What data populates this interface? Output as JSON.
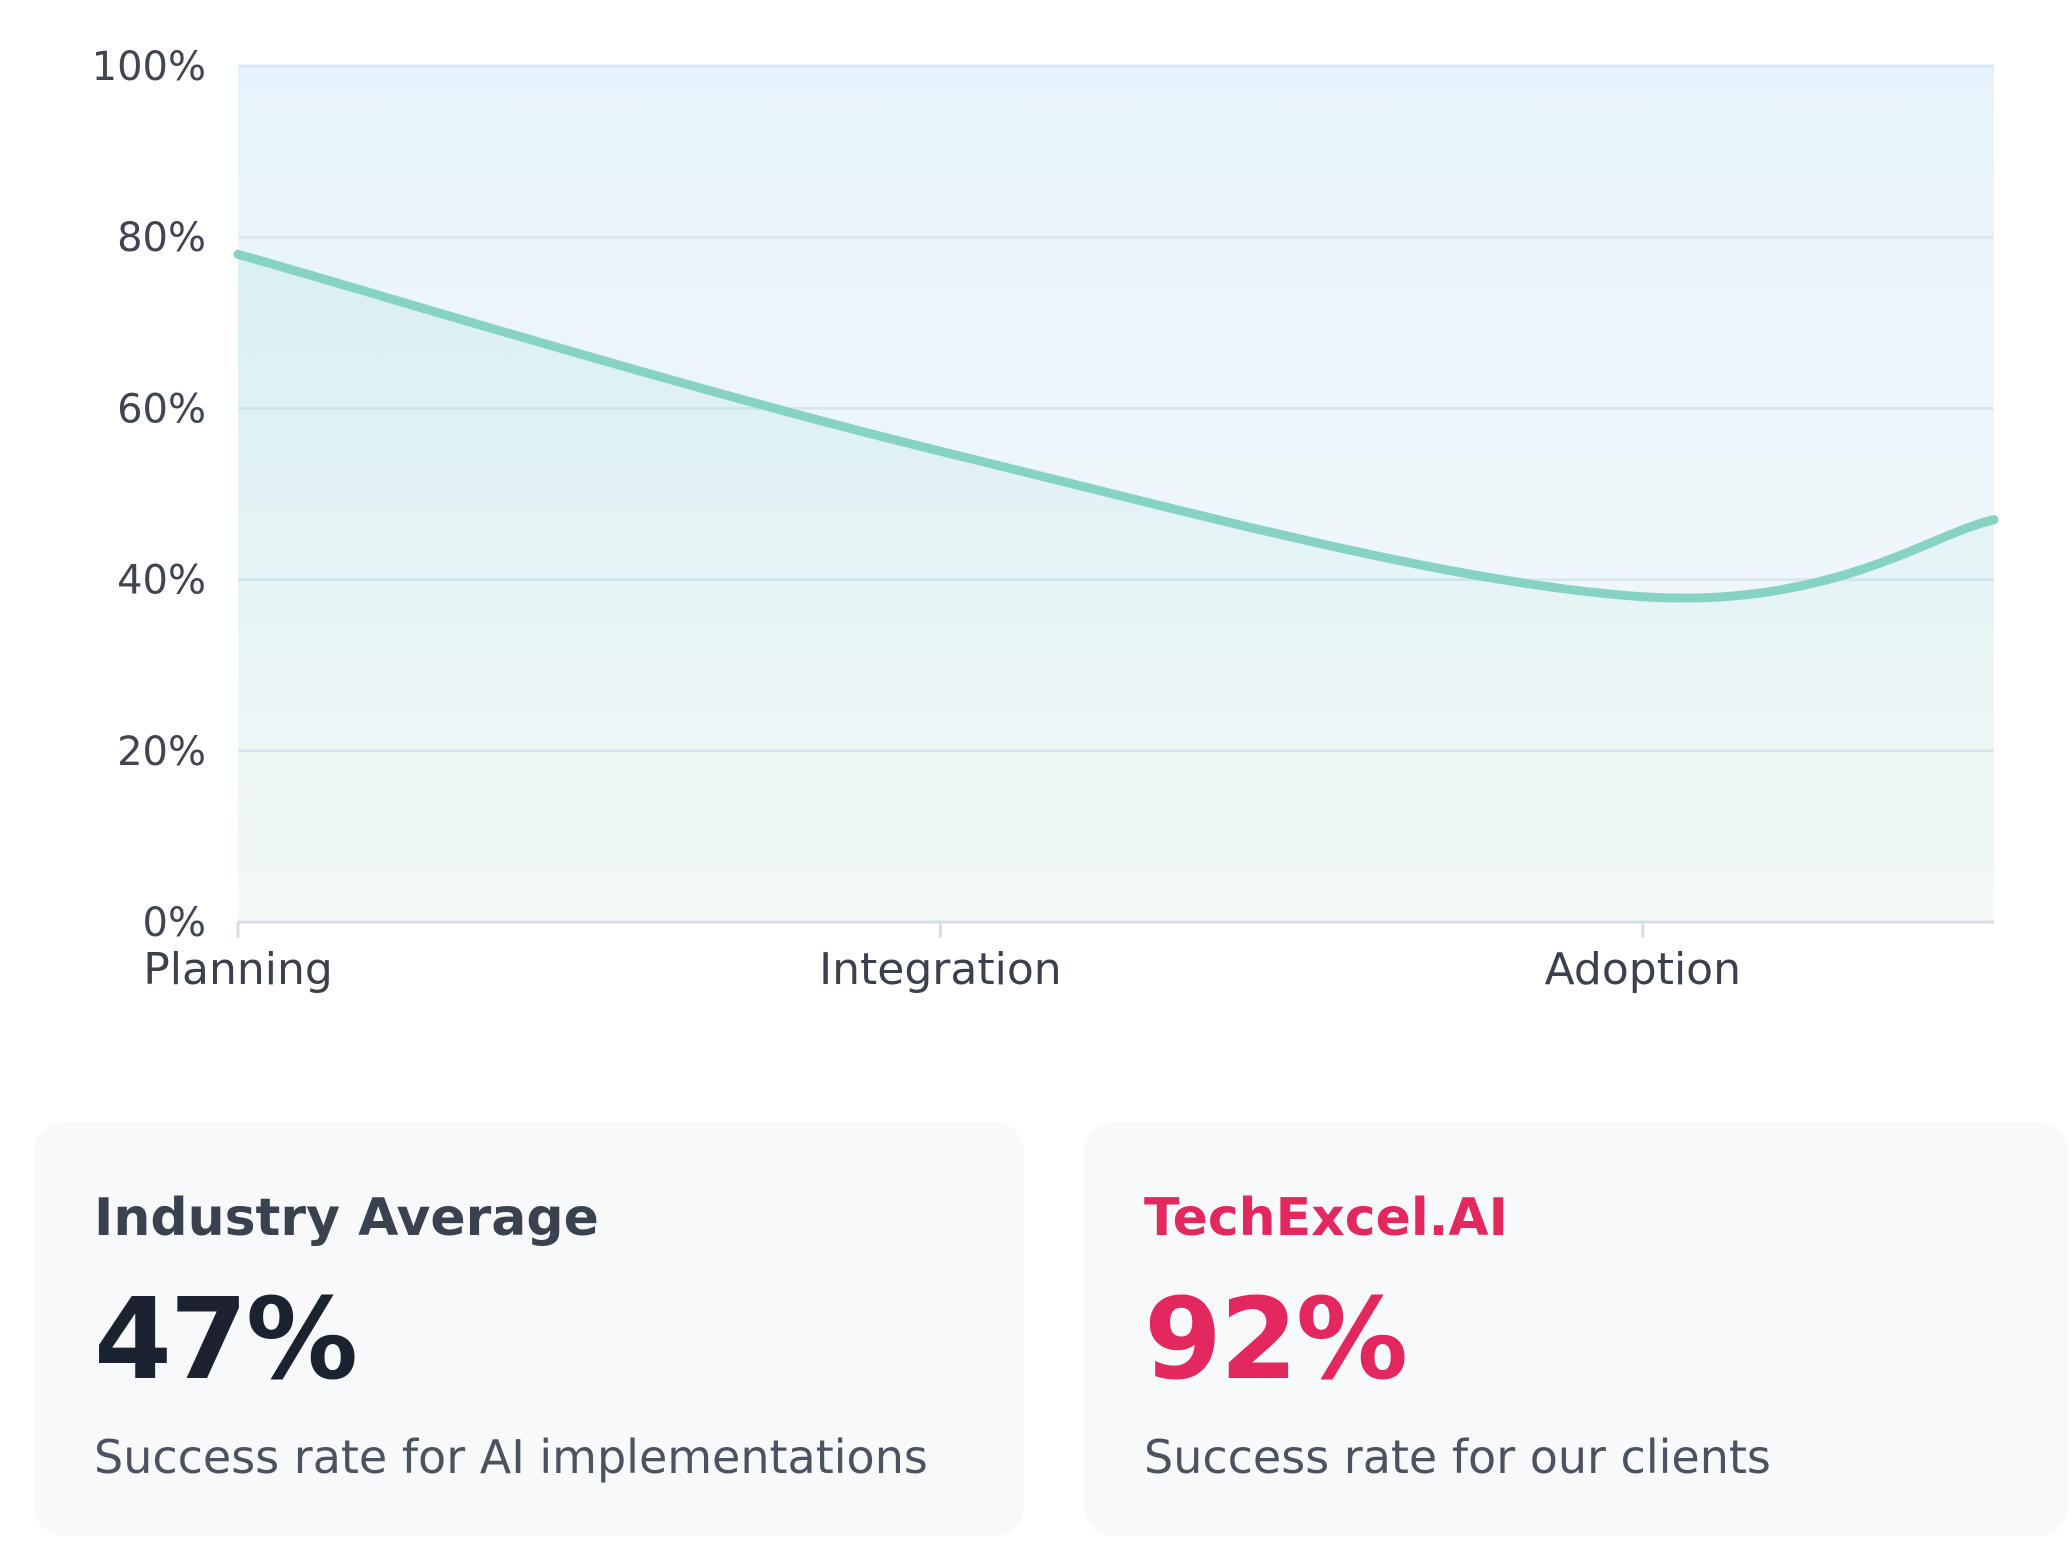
{
  "colors": {
    "line": "#86d3c3",
    "area_top": "#e7f3fc",
    "area_bottom": "#f5faf8",
    "grid": "#dbe7f0",
    "accent": "#e2285f",
    "card_bg": "#f7f9fb"
  },
  "chart_data": {
    "type": "area",
    "title": "",
    "xlabel": "",
    "ylabel": "",
    "categories": [
      "Planning",
      "Integration",
      "Adoption"
    ],
    "x": [
      0,
      1,
      2,
      2.5
    ],
    "y": [
      78,
      55,
      38,
      47
    ],
    "y_tick_labels": [
      "100%",
      "80%",
      "60%",
      "40%",
      "20%",
      "0%"
    ],
    "y_ticks": [
      100,
      80,
      60,
      40,
      20,
      0
    ],
    "ylim": [
      0,
      100
    ],
    "xlim": [
      0,
      2.5
    ],
    "y_unit": "%",
    "grid": true,
    "legend": "none",
    "series": [
      {
        "values": [
          78,
          55,
          38,
          47
        ]
      }
    ]
  },
  "cards": [
    {
      "title": "Industry Average",
      "value": "47%",
      "description": "Success rate for AI implementations"
    },
    {
      "title": "TechExcel.AI",
      "value": "92%",
      "description": "Success rate for our clients"
    }
  ]
}
